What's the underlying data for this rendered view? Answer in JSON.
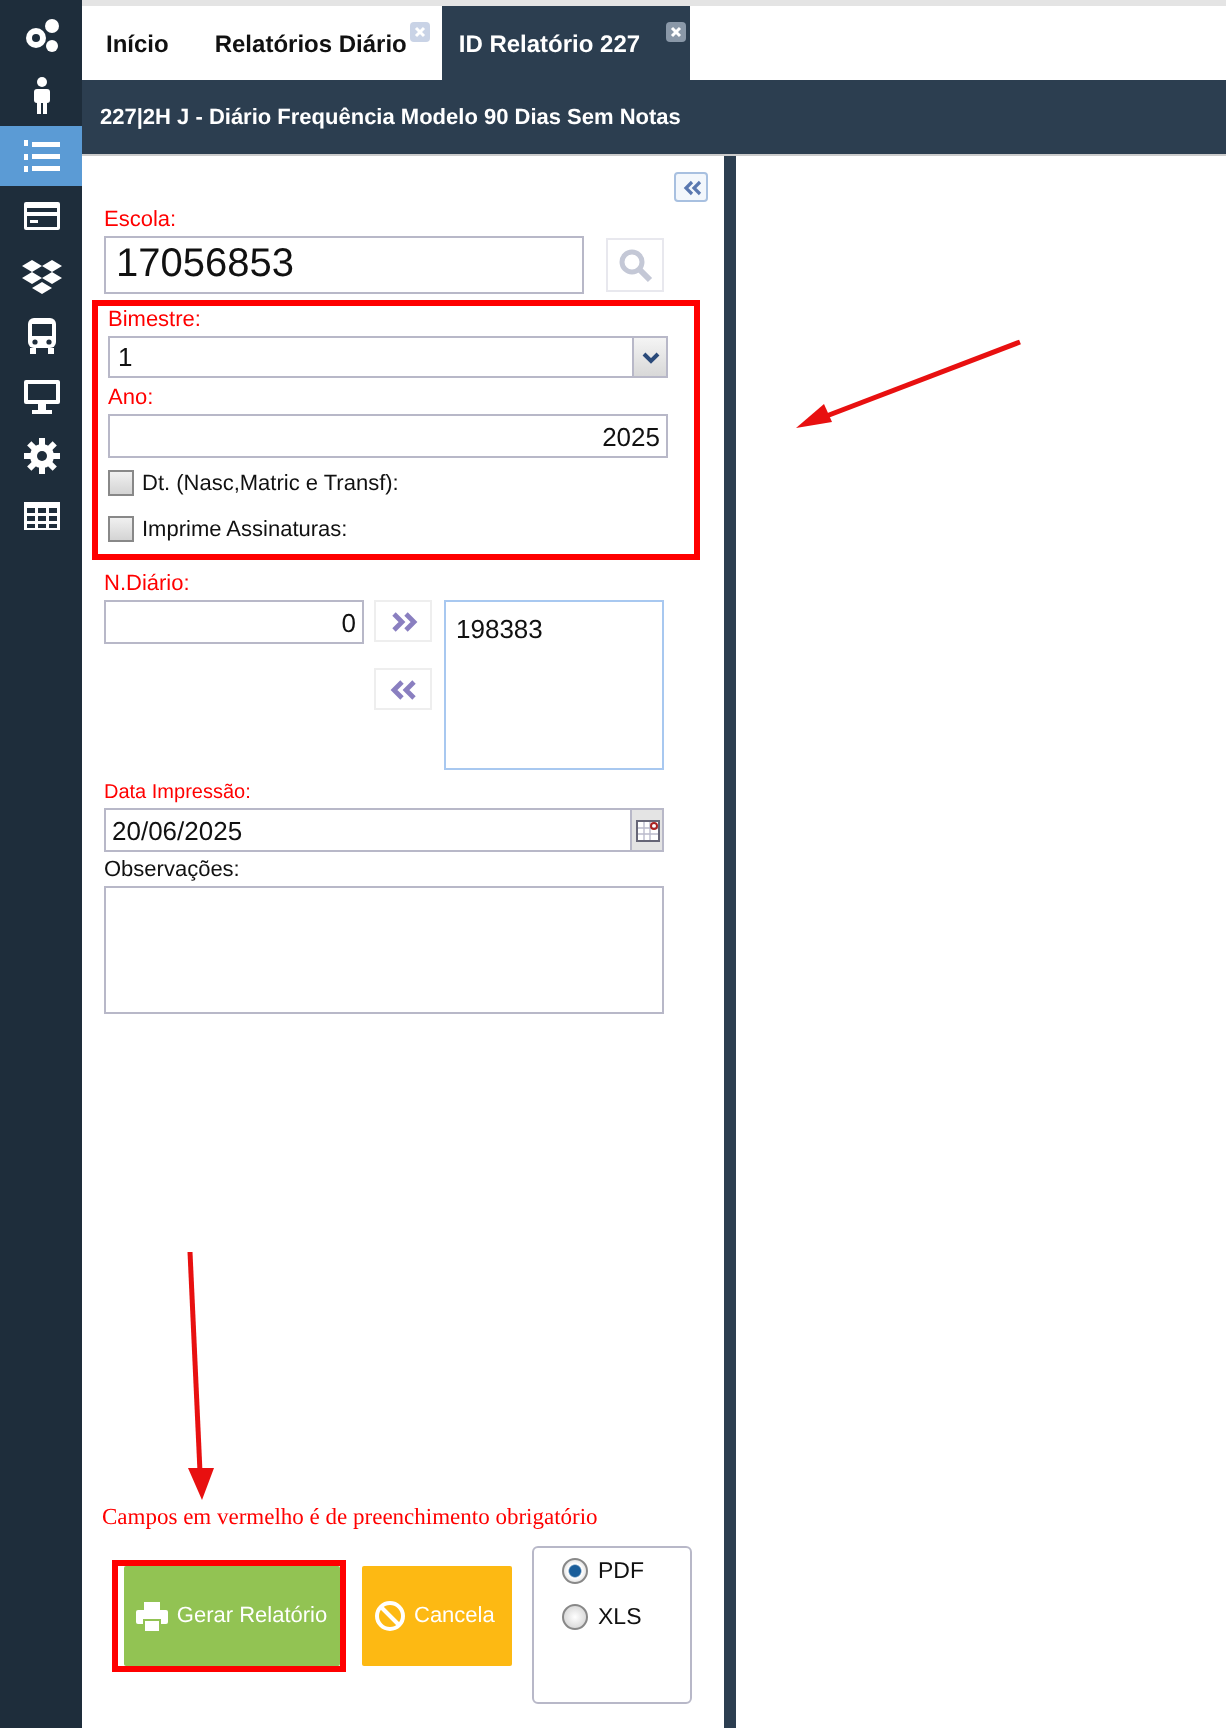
{
  "sidebar": {
    "items": [
      {
        "selected": false
      },
      {
        "selected": false
      },
      {
        "selected": true
      },
      {
        "selected": false
      },
      {
        "selected": false
      },
      {
        "selected": false
      },
      {
        "selected": false
      },
      {
        "selected": false
      },
      {
        "selected": false
      }
    ]
  },
  "tabs": [
    {
      "label": "Início",
      "selected": false,
      "closable": false
    },
    {
      "label": "Relatórios Diário",
      "selected": false,
      "closable": true
    },
    {
      "label": "ID Relatório 227",
      "selected": true,
      "closable": true
    }
  ],
  "header": {
    "title": "227|2H J - Diário Frequência Modelo 90 Dias Sem Notas"
  },
  "form": {
    "escola": {
      "label": "Escola:",
      "value": "17056853"
    },
    "highlighted_group": true,
    "bimestre": {
      "label": "Bimestre:",
      "value": "1"
    },
    "ano": {
      "label": "Ano:",
      "value": "2025"
    },
    "checkboxes": [
      {
        "label": "Dt. (Nasc,Matric e Transf):",
        "checked": false
      },
      {
        "label": "Imprime Assinaturas:",
        "checked": false
      }
    ],
    "n_diario": {
      "label": "N.Diário:",
      "value": "0",
      "selected_items": [
        "198383"
      ]
    },
    "data_impressao": {
      "label": "Data Impressão:",
      "value": "20/06/2025"
    },
    "observacoes": {
      "label": "Observações:"
    },
    "note": "Campos em vermelho é de preenchimento obrigatório",
    "buttons": [
      {
        "kind": "generate",
        "label": "Gerar Relatório",
        "highlighted": true
      },
      {
        "kind": "cancel",
        "label": "Cancela",
        "highlighted": false
      }
    ],
    "formats": [
      {
        "label": "PDF",
        "selected": true
      },
      {
        "label": "XLS",
        "selected": false
      }
    ]
  },
  "annotation_arrows": true
}
